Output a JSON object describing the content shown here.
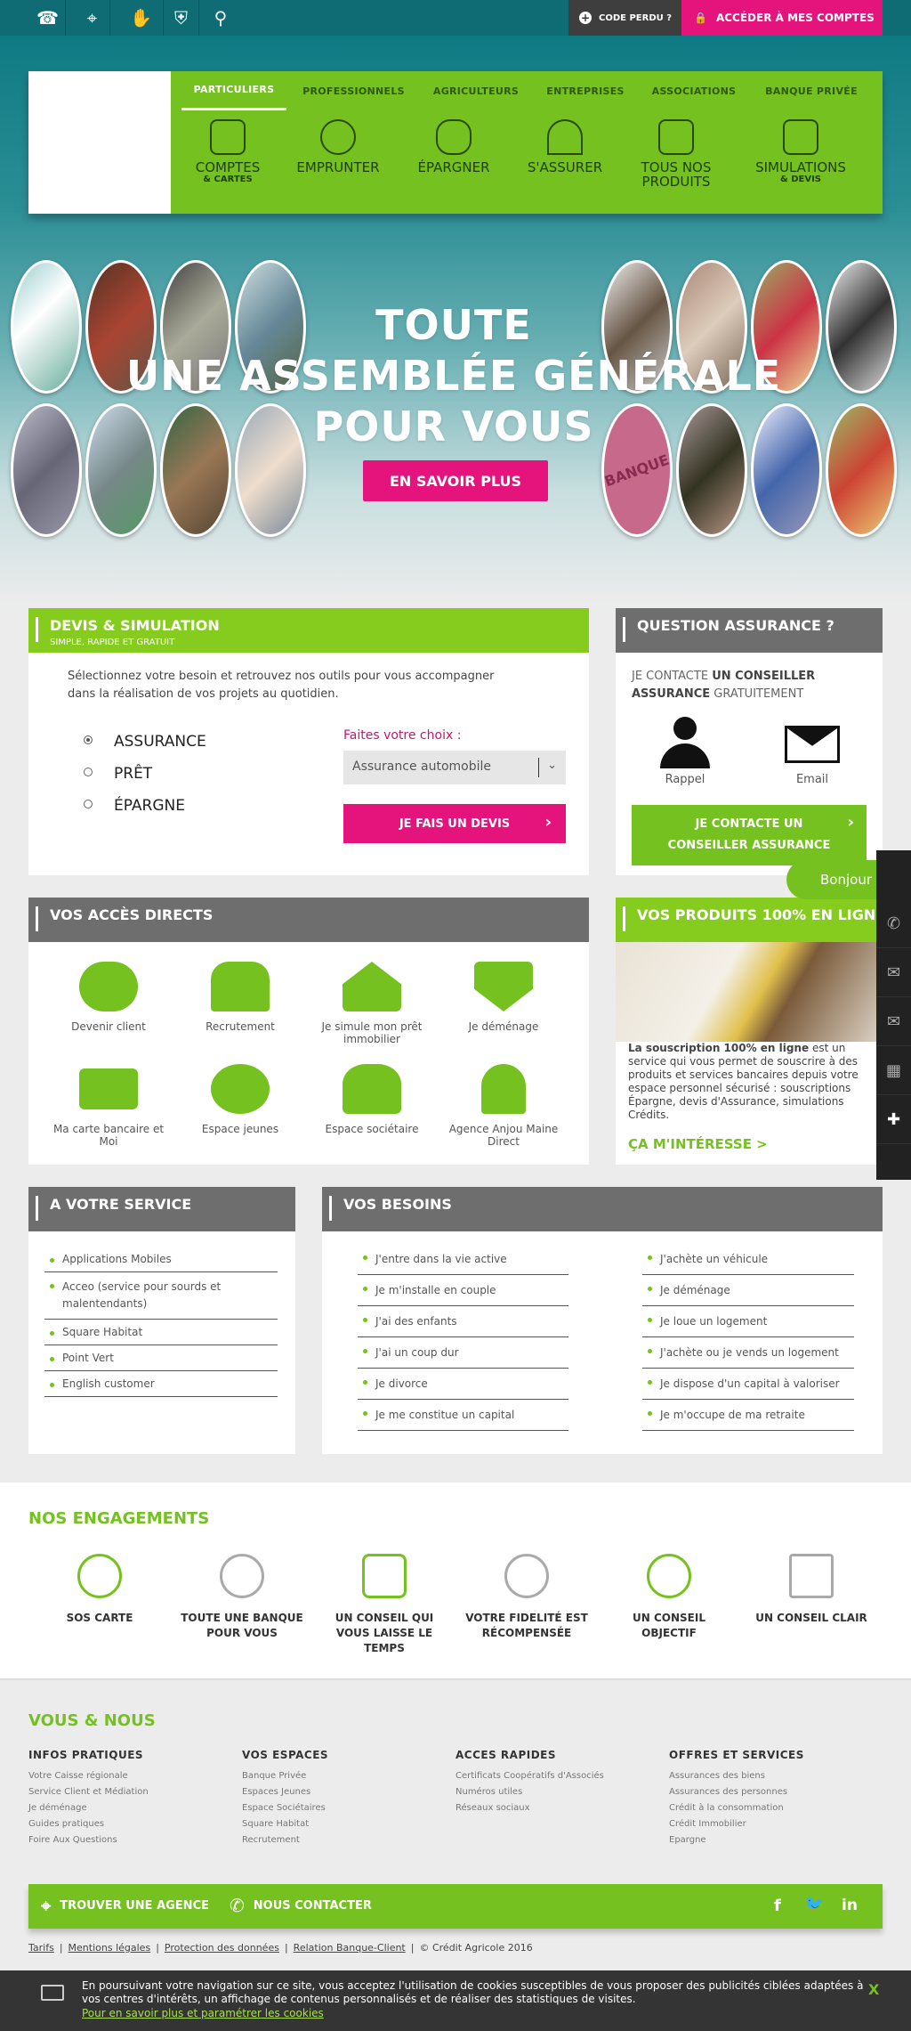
{
  "topbar": {
    "code_perdu": "CODE PERDU ?",
    "acces": "ACCÉDER À MES COMPTES"
  },
  "nav": {
    "tabs": [
      "PARTICULIERS",
      "PROFESSIONNELS",
      "AGRICULTEURS",
      "ENTREPRISES",
      "ASSOCIATIONS",
      "BANQUE PRIVÉE"
    ],
    "items": [
      {
        "l1": "COMPTES",
        "l2": "& CARTES"
      },
      {
        "l1": "EMPRUNTER",
        "l2": ""
      },
      {
        "l1": "ÉPARGNER",
        "l2": ""
      },
      {
        "l1": "S'ASSURER",
        "l2": ""
      },
      {
        "l1": "TOUS NOS",
        "l2": "PRODUITS"
      },
      {
        "l1": "SIMULATIONS",
        "l2": "& DEVIS"
      }
    ]
  },
  "hero": {
    "line1": "TOUTE",
    "line2": "UNE ASSEMBLÉE GÉNÉRALE",
    "line3": "POUR VOUS",
    "button": "EN SAVOIR PLUS",
    "badge_text": "BANQUE"
  },
  "devis": {
    "title": "DEVIS & SIMULATION",
    "subtitle": "SIMPLE, RAPIDE ET GRATUIT",
    "intro": "Sélectionnez votre besoin et retrouvez nos outils pour vous accompagner dans la réalisation de vos projets au quotidien.",
    "options": [
      "ASSURANCE",
      "PRÊT",
      "ÉPARGNE"
    ],
    "choice_label": "Faites votre choix :",
    "select_value": "Assurance automobile",
    "button": "JE FAIS UN DEVIS"
  },
  "question": {
    "title": "QUESTION ASSURANCE ?",
    "p1": "JE CONTACTE ",
    "p2": "UN CONSEILLER ASSURANCE",
    "p3": " GRATUITEMENT",
    "rappel": "Rappel",
    "email": "Email",
    "button": "JE CONTACTE UN CONSEILLER ASSURANCE",
    "bubble": "Bonjour"
  },
  "acces": {
    "title": "VOS ACCÈS DIRECTS",
    "items": [
      "Devenir client",
      "Recrutement",
      "Je simule mon prêt immobilier",
      "Je déménage",
      "Ma carte bancaire et Moi",
      "Espace jeunes",
      "Espace sociétaire",
      "Agence Anjou Maine Direct"
    ]
  },
  "produits": {
    "title": "VOS PRODUITS 100% EN LIGNE",
    "bold": "La souscription 100% en ligne",
    "text": " est un service qui vous permet de souscrire à des produits et services bancaires depuis votre espace personnel sécurisé : souscriptions Épargne, devis d'Assurance, simulations Crédits.",
    "link": "ÇA M'INTÉRESSE >"
  },
  "service": {
    "title": "A VOTRE SERVICE",
    "items": [
      "Applications Mobiles",
      "Acceo (service pour sourds et malentendants)",
      "Square Habitat",
      "Point Vert",
      "English customer"
    ]
  },
  "besoins": {
    "title": "VOS BESOINS",
    "col1": [
      "J'entre dans la vie active",
      "Je m'installe en couple",
      "J'ai des enfants",
      "J'ai un coup dur",
      "Je divorce",
      "Je me constitue un capital"
    ],
    "col2": [
      "J'achète un véhicule",
      "Je déménage",
      "Je loue un logement",
      "J'achète ou je vends un logement",
      "Je dispose d'un capital à valoriser",
      "Je m'occupe de ma retraite"
    ]
  },
  "engagements": {
    "title": "NOS ENGAGEMENTS",
    "items": [
      "SOS CARTE",
      "TOUTE UNE BANQUE POUR VOUS",
      "UN CONSEIL QUI VOUS LAISSE LE TEMPS",
      "VOTRE FIDELITÉ EST RÉCOMPENSÉE",
      "UN CONSEIL OBJECTIF",
      "UN CONSEIL CLAIR"
    ]
  },
  "footer": {
    "title": "VOUS & NOUS",
    "cols": [
      {
        "h": "INFOS PRATIQUES",
        "items": [
          "Votre Caisse régionale",
          "Service Client et Médiation",
          "Je déménage",
          "Guides pratiques",
          "Foire Aux Questions"
        ]
      },
      {
        "h": "VOS ESPACES",
        "items": [
          "Banque Privée",
          "Espaces Jeunes",
          "Espace Sociétaires",
          "Square Habitat",
          "Recrutement"
        ]
      },
      {
        "h": "ACCES RAPIDES",
        "items": [
          "Certificats Coopératifs d'Associés",
          "Numéros utiles",
          "Réseaux sociaux"
        ]
      },
      {
        "h": "OFFRES ET SERVICES",
        "items": [
          "Assurances des biens",
          "Assurances des personnes",
          "Crédit à la consommation",
          "Crédit Immobilier",
          "Epargne"
        ]
      }
    ],
    "agence": "TROUVER UNE AGENCE",
    "contact": "NOUS CONTACTER",
    "links": [
      "Tarifs",
      "Mentions légales",
      "Protection des données",
      "Relation Banque-Client"
    ],
    "copyright": "© Crédit Agricole 2016"
  },
  "cookie": {
    "text": "En poursuivant votre navigation sur ce site, vous acceptez l'utilisation de cookies susceptibles de vous proposer des publicités ciblées adaptées à vos centres d'intérêts, un affichage de contenus personnalisés et de réaliser des statistiques de visites.",
    "link": "Pour en savoir plus et paramétrer les cookies",
    "close": "X"
  },
  "colors": {
    "green": "#74c11f",
    "pink": "#e5147c",
    "teal": "#0f6c74",
    "grey": "#6e6e6e"
  }
}
